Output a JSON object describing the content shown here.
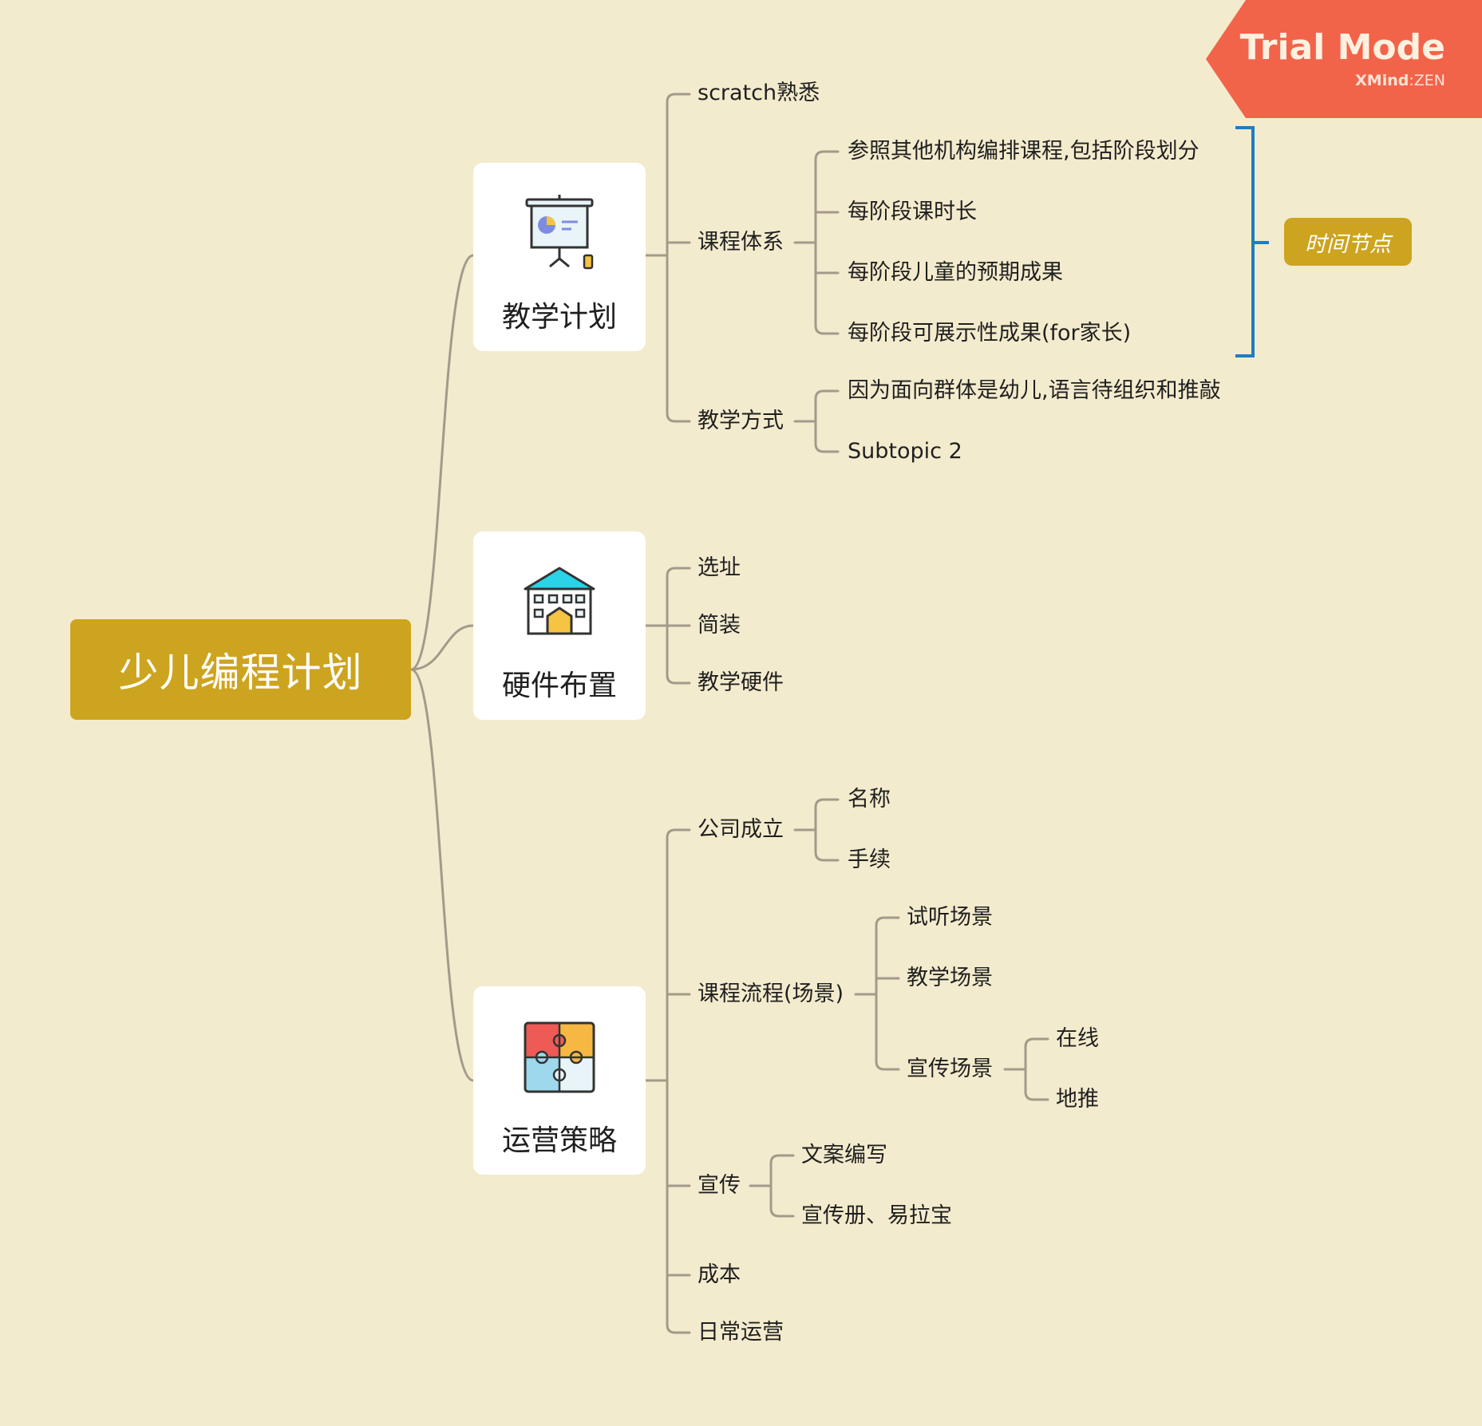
{
  "root": {
    "label": "少儿编程计划"
  },
  "branches": [
    {
      "label": "教学计划",
      "icon": "presentation-board-icon"
    },
    {
      "label": "硬件布置",
      "icon": "building-icon"
    },
    {
      "label": "运营策略",
      "icon": "puzzle-icon"
    }
  ],
  "teaching": {
    "scratch": "scratch熟悉",
    "course_system": {
      "label": "课程体系",
      "children": [
        "参照其他机构编排课程,包括阶段划分",
        "每阶段课时长",
        "每阶段儿童的预期成果",
        "每阶段可展示性成果(for家长)"
      ]
    },
    "method": {
      "label": "教学方式",
      "children": [
        "因为面向群体是幼儿,语言待组织和推敲",
        "Subtopic 2"
      ]
    }
  },
  "hardware": {
    "children": [
      "选址",
      "简装",
      "教学硬件"
    ]
  },
  "operations": {
    "company": {
      "label": "公司成立",
      "children": [
        "名称",
        "手续"
      ]
    },
    "flow": {
      "label": "课程流程(场景)",
      "children": [
        "试听场景",
        "教学场景",
        "宣传场景"
      ],
      "promo_children": [
        "在线",
        "地推"
      ]
    },
    "promo": {
      "label": "宣传",
      "children": [
        "文案编写",
        "宣传册、易拉宝"
      ]
    },
    "cost": "成本",
    "daily": "日常运营"
  },
  "summary": {
    "label": "时间节点"
  },
  "watermark": {
    "title": "Trial Mode",
    "brand": "XMind",
    "edition": "ZEN"
  },
  "colors": {
    "background": "#F3EBCD",
    "accent": "#CDA41F",
    "summary_bracket": "#1F7CC4",
    "trial": "#F2644A",
    "connector": "#A39A8B"
  }
}
